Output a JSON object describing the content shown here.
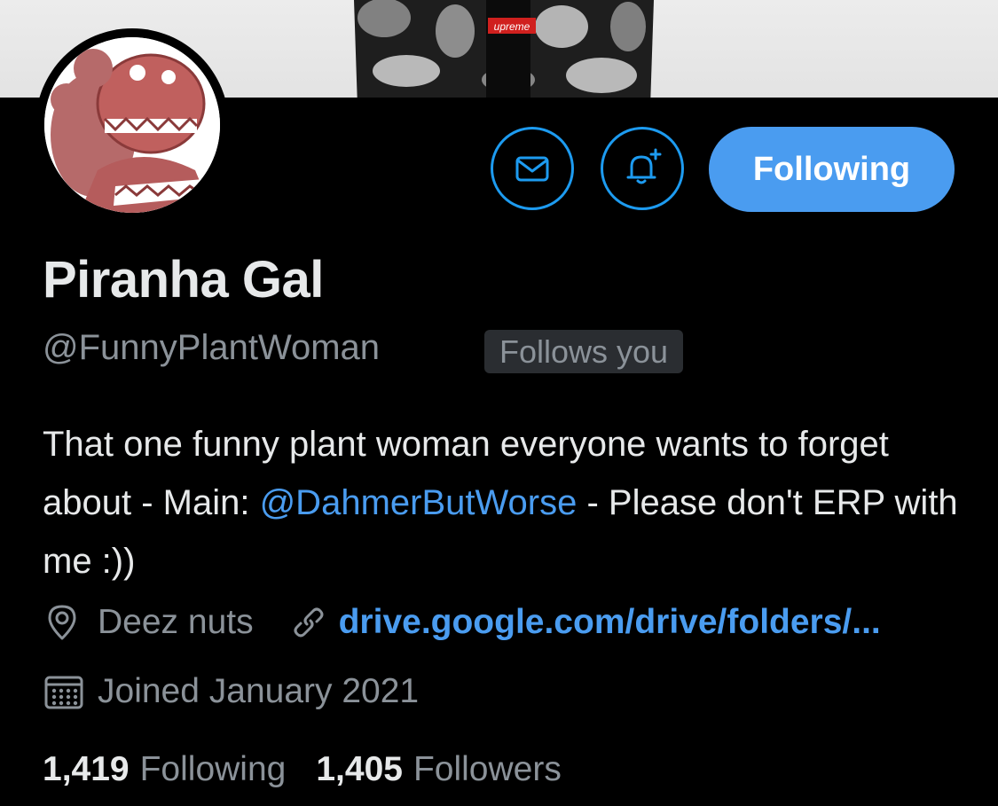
{
  "banner": {
    "shirt_brand_text": "upreme"
  },
  "avatar": {
    "icon": "piranha-gal-avatar"
  },
  "actions": {
    "message_icon": "mail-icon",
    "notify_icon": "bell-plus-icon",
    "follow_label": "Following"
  },
  "profile": {
    "display_name": "Piranha Gal",
    "handle": "@FunnyPlantWoman",
    "follows_you_badge": "Follows you"
  },
  "bio": {
    "part1": "That one funny plant woman everyone wants to forget about - Main: ",
    "mention": "@DahmerButWorse",
    "part2": " - Please don't ERP with me :))"
  },
  "meta": {
    "location": "Deez nuts",
    "link": "drive.google.com/drive/folders/...",
    "joined": "Joined January 2021"
  },
  "stats": {
    "following_count": "1,419",
    "following_label": "Following",
    "followers_count": "1,405",
    "followers_label": "Followers"
  },
  "colors": {
    "accent": "#4a9cf0",
    "background": "#000000",
    "text_primary": "#e7e9ea",
    "text_secondary": "#8b9299"
  }
}
